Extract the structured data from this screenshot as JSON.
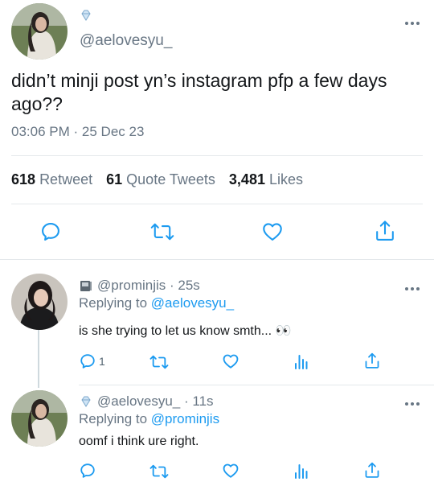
{
  "main_tweet": {
    "handle": "@aelovesyu_",
    "text": "didn’t minji post yn’s instagram pfp a few days ago??",
    "time": "03:06 PM",
    "date_sep": "·",
    "date": "25 Dec 23",
    "stats": {
      "retweets_count": "618",
      "retweets_label": "Retweet",
      "quotes_count": "61",
      "quotes_label": "Quote Tweets",
      "likes_count": "3,481",
      "likes_label": "Likes"
    }
  },
  "replies": [
    {
      "handle": "@prominjis",
      "time": "· 25s",
      "replying_prefix": "Replying to",
      "replying_to": "@aelovesyu_",
      "text": "is she trying to let us know smth... 👀",
      "reply_count": "1"
    },
    {
      "handle": "@aelovesyu_",
      "time": "· 11s",
      "replying_prefix": "Replying to",
      "replying_to": "@prominjis",
      "text": "oomf i think ure right.",
      "reply_count": ""
    }
  ],
  "colors": {
    "accent": "#1d9bf0",
    "icon": "#1d9bf0",
    "secondary_text": "#687684"
  }
}
